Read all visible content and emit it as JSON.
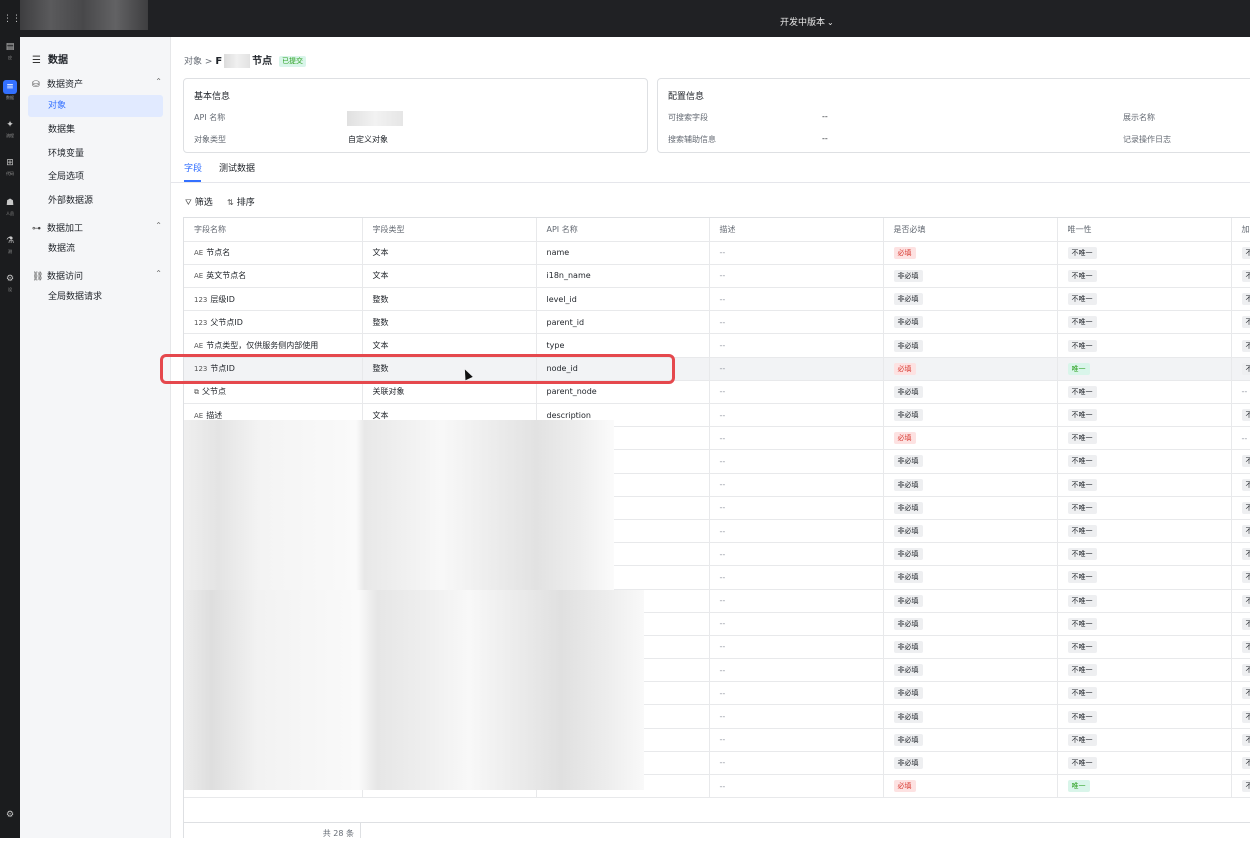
{
  "topbar": {
    "version_label": "开发中版本",
    "chevron": "⌄"
  },
  "rail": [
    {
      "icon": "grid-icon",
      "glyph": "⋮⋮",
      "label": ""
    },
    {
      "icon": "app-icon",
      "glyph": "▤",
      "label": "应"
    },
    {
      "icon": "data-icon",
      "glyph": "≡",
      "label": "数据",
      "active": true
    },
    {
      "icon": "flow-icon",
      "glyph": "✦",
      "label": "流程"
    },
    {
      "icon": "code-icon",
      "glyph": "⊞",
      "label": "代码"
    },
    {
      "icon": "people-icon",
      "glyph": "☗",
      "label": "人员"
    },
    {
      "icon": "test-icon",
      "glyph": "⚗",
      "label": "测"
    },
    {
      "icon": "setting-icon",
      "glyph": "⚙",
      "label": "设"
    }
  ],
  "sidebar": {
    "title": "数据",
    "groups": [
      {
        "label": "数据资产",
        "items": [
          "对象",
          "数据集",
          "环境变量",
          "全局选项",
          "外部数据源"
        ]
      },
      {
        "label": "数据加工",
        "items": [
          "数据流"
        ]
      },
      {
        "label": "数据访问",
        "items": [
          "全局数据请求"
        ]
      }
    ],
    "active_item": "对象"
  },
  "breadcrumb": {
    "root": "对象",
    "sep": ">",
    "current_prefix": "F",
    "current_suffix": "节点",
    "status": "已提交"
  },
  "basic_info": {
    "title": "基本信息",
    "api_name_label": "API 名称",
    "type_label": "对象类型",
    "type_value": "自定义对象"
  },
  "config_info": {
    "title": "配置信息",
    "searchable_label": "可搜索字段",
    "searchable_value": "--",
    "search_aux_label": "搜索辅助信息",
    "search_aux_value": "--",
    "display_name_label": "展示名称",
    "log_label": "记录操作日志"
  },
  "tabs": [
    "字段",
    "测试数据"
  ],
  "toolbar": {
    "filter": "筛选",
    "sort": "排序"
  },
  "table": {
    "headers": [
      "字段名称",
      "字段类型",
      "API 名称",
      "描述",
      "是否必填",
      "唯一性",
      "加密"
    ],
    "rows": [
      {
        "icon": "AE",
        "name": "节点名",
        "type": "文本",
        "api": "name",
        "desc": "--",
        "req": "必填",
        "uniq": "不唯一",
        "enc": "不加"
      },
      {
        "icon": "AE",
        "name": "英文节点名",
        "type": "文本",
        "api": "i18n_name",
        "desc": "--",
        "req": "非必填",
        "uniq": "不唯一",
        "enc": "不加"
      },
      {
        "icon": "123",
        "name": "层级ID",
        "type": "整数",
        "api": "level_id",
        "desc": "--",
        "req": "非必填",
        "uniq": "不唯一",
        "enc": "不加"
      },
      {
        "icon": "123",
        "name": "父节点ID",
        "type": "整数",
        "api": "parent_id",
        "desc": "--",
        "req": "非必填",
        "uniq": "不唯一",
        "enc": "不加"
      },
      {
        "icon": "AE",
        "name": "节点类型，仅供服务侧内部使用",
        "type": "文本",
        "api": "type",
        "desc": "--",
        "req": "非必填",
        "uniq": "不唯一",
        "enc": "不加"
      },
      {
        "icon": "123",
        "name": "节点ID",
        "type": "整数",
        "api": "node_id",
        "desc": "--",
        "req": "必填",
        "uniq": "唯一",
        "enc": "不加",
        "highlight": true
      },
      {
        "icon": "⧉",
        "name": "父节点",
        "type": "关联对象",
        "api": "parent_node",
        "desc": "--",
        "req": "非必填",
        "uniq": "不唯一",
        "enc": "--"
      },
      {
        "icon": "AE",
        "name": "描述",
        "type": "文本",
        "api": "description",
        "desc": "--",
        "req": "非必填",
        "uniq": "不唯一",
        "enc": "不加"
      },
      {
        "icon": "",
        "name": "",
        "type": "",
        "api": "",
        "desc": "--",
        "req": "必填",
        "uniq": "不唯一",
        "enc": "--"
      },
      {
        "icon": "",
        "name": "",
        "type": "",
        "api": "",
        "desc": "--",
        "req": "非必填",
        "uniq": "不唯一",
        "enc": "不加"
      },
      {
        "icon": "",
        "name": "",
        "type": "",
        "api": "",
        "desc": "--",
        "req": "非必填",
        "uniq": "不唯一",
        "enc": "不加"
      },
      {
        "icon": "",
        "name": "",
        "type": "",
        "api": "",
        "desc": "--",
        "req": "非必填",
        "uniq": "不唯一",
        "enc": "不加"
      },
      {
        "icon": "",
        "name": "",
        "type": "",
        "api": "",
        "desc": "--",
        "req": "非必填",
        "uniq": "不唯一",
        "enc": "不加"
      },
      {
        "icon": "",
        "name": "",
        "type": "",
        "api": "",
        "desc": "--",
        "req": "非必填",
        "uniq": "不唯一",
        "enc": "不加"
      },
      {
        "icon": "",
        "name": "",
        "type": "",
        "api": "",
        "desc": "--",
        "req": "非必填",
        "uniq": "不唯一",
        "enc": "不加"
      },
      {
        "icon": "",
        "name": "",
        "type": "",
        "api": "",
        "desc": "--",
        "req": "非必填",
        "uniq": "不唯一",
        "enc": "不加"
      },
      {
        "icon": "",
        "name": "",
        "type": "",
        "api": "",
        "desc": "--",
        "req": "非必填",
        "uniq": "不唯一",
        "enc": "不加"
      },
      {
        "icon": "",
        "name": "",
        "type": "",
        "api": "",
        "desc": "--",
        "req": "非必填",
        "uniq": "不唯一",
        "enc": "不加"
      },
      {
        "icon": "",
        "name": "",
        "type": "",
        "api": "",
        "desc": "--",
        "req": "非必填",
        "uniq": "不唯一",
        "enc": "不加"
      },
      {
        "icon": "",
        "name": "",
        "type": "",
        "api": "",
        "desc": "--",
        "req": "非必填",
        "uniq": "不唯一",
        "enc": "不加"
      },
      {
        "icon": "",
        "name": "",
        "type": "",
        "api": "",
        "desc": "--",
        "req": "非必填",
        "uniq": "不唯一",
        "enc": "不加"
      },
      {
        "icon": "",
        "name": "",
        "type": "",
        "api": "",
        "desc": "--",
        "req": "非必填",
        "uniq": "不唯一",
        "enc": "不加"
      },
      {
        "icon": "",
        "name": "",
        "type": "",
        "api": "",
        "desc": "--",
        "req": "非必填",
        "uniq": "不唯一",
        "enc": "不加"
      },
      {
        "icon": "",
        "name": "",
        "type": "",
        "api": "",
        "desc": "--",
        "req": "必填",
        "uniq": "唯一",
        "enc": "不加"
      }
    ],
    "total": "共 28 条"
  },
  "colors": {
    "accent": "#3370ff",
    "highlight_border": "#e5484d"
  }
}
